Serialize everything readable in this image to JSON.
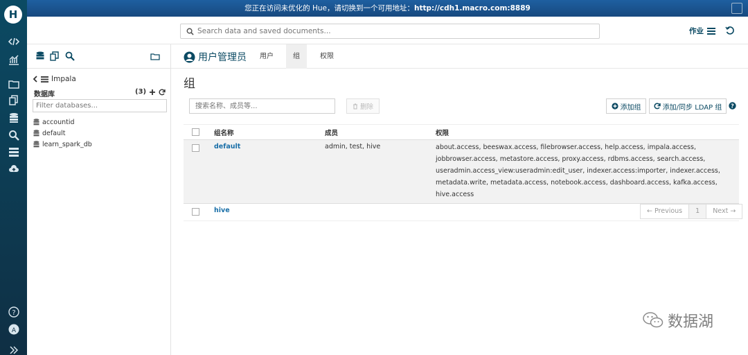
{
  "banner": {
    "text": "您正在访问未优化的 Hue，请切换到一个可用地址：",
    "url": "http://cdh1.macro.com:8889"
  },
  "logo": "H",
  "search": {
    "placeholder": "Search data and saved documents..."
  },
  "topbar": {
    "jobs_label": "作业"
  },
  "assist": {
    "breadcrumb": "Impala",
    "databases_label": "数据库",
    "databases_count": "(3)",
    "filter_placeholder": "Filter databases...",
    "databases": [
      "accountid",
      "default",
      "learn_spark_db"
    ]
  },
  "main": {
    "app_title": "用户管理员",
    "tabs": [
      {
        "label": "用户",
        "active": false
      },
      {
        "label": "组",
        "active": true
      },
      {
        "label": "权限",
        "active": false
      }
    ],
    "page_title": "组",
    "filter_placeholder": "搜索名称、成员等...",
    "delete_label": "删除",
    "add_group_label": "添加组",
    "ldap_label": "添加/同步 LDAP 组"
  },
  "table": {
    "headers": [
      "组名称",
      "成员",
      "权限"
    ],
    "rows": [
      {
        "name": "default",
        "members": "admin, test, hive",
        "permissions": "about.access, beeswax.access, filebrowser.access, help.access, impala.access, jobbrowser.access, metastore.access, proxy.access, rdbms.access, search.access, useradmin.access_view:useradmin:edit_user, indexer.access:importer, indexer.access, metadata.write, metadata.access, notebook.access, dashboard.access, kafka.access, hive.access"
      },
      {
        "name": "hive",
        "members": "",
        "permissions": ""
      }
    ]
  },
  "pager": {
    "previous": "← Previous",
    "page": "1",
    "next": "Next →"
  },
  "watermark": "数据湖",
  "colors": {
    "nav_bg": "#0b4a63",
    "banner_bg": "#1e5fa0",
    "link": "#1a6fa8"
  }
}
